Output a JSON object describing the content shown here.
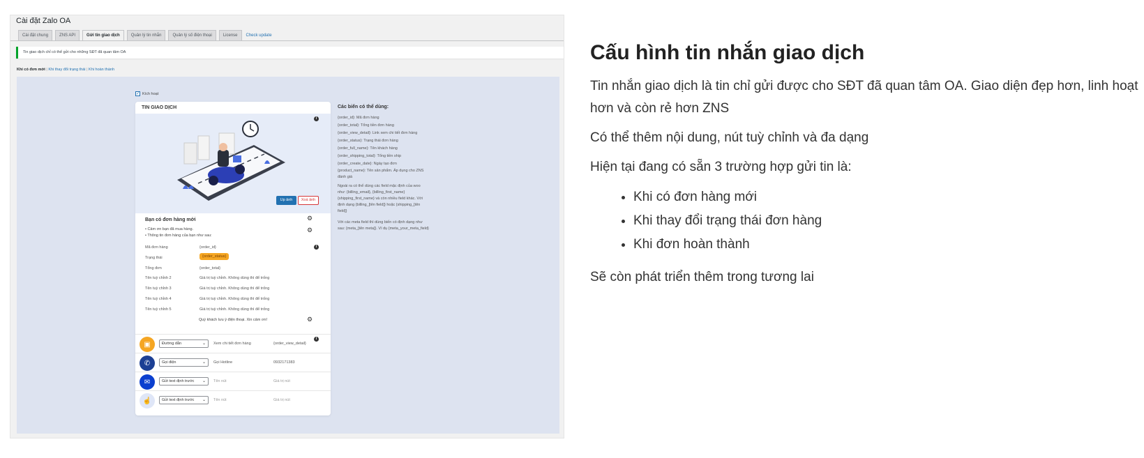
{
  "screenshot": {
    "window_title": "Cài đặt Zalo OA",
    "tabs": [
      {
        "label": "Cài đặt chung",
        "active": false
      },
      {
        "label": "ZNS API",
        "active": false
      },
      {
        "label": "Gửi tin giao dịch",
        "active": true
      },
      {
        "label": "Quản lý tin nhắn",
        "active": false
      },
      {
        "label": "Quản lý số điện thoại",
        "active": false
      },
      {
        "label": "License",
        "active": false
      }
    ],
    "check_update": "Check update",
    "notice": "Tin giao dịch chỉ có thể gửi cho những SĐT đã quan tâm OA",
    "subnav": {
      "active": "Khi có đơn mới",
      "sep1": "|",
      "link1": "Khi thay đổi trạng thái",
      "sep2": "|",
      "link2": "Khi hoàn thành"
    },
    "enable_label": "Kích hoạt",
    "card": {
      "header": "TIN GIAO DỊCH",
      "upload_btn": "Up ảnh",
      "delete_btn": "Xoá ảnh",
      "title": "Bạn có đơn hàng mới",
      "intro_line1": "• Cảm ơn bạn đã mua hàng.",
      "intro_line2": "• Thông tin đơn hàng của bạn như sau:",
      "rows": [
        {
          "label": "Mã đơn hàng",
          "value": "{order_id}"
        },
        {
          "label": "Trạng thái",
          "value": "{order_status}"
        },
        {
          "label": "Tổng đơn",
          "value": "{order_total}"
        },
        {
          "label": "Tên tuỳ chỉnh 2",
          "value": "Giá trị tuỳ chỉnh. Không dùng thì để trống"
        },
        {
          "label": "Tên tuỳ chỉnh 3",
          "value": "Giá trị tuỳ chỉnh. Không dùng thì để trống"
        },
        {
          "label": "Tên tuỳ chỉnh 4",
          "value": "Giá trị tuỳ chỉnh. Không dùng thì để trống"
        },
        {
          "label": "Tên tuỳ chỉnh 5",
          "value": "Giá trị tuỳ chỉnh. Không dùng thì để trống"
        }
      ],
      "footer_note": "Quý khách lưu ý điện thoại. Xin cảm ơn!",
      "buttons": [
        {
          "type": "Đường dẫn",
          "text": "Xem chi tiết đơn hàng",
          "value": "{order_view_detail}",
          "color": "#f5a623",
          "icon": "shop-icon"
        },
        {
          "type": "Gọi điện",
          "text": "Gọi Hotline",
          "value": "0932171383",
          "color": "#1c3f94",
          "icon": "phone-icon"
        },
        {
          "type": "Gửi text định trước",
          "text": "Tên nút",
          "value": "Giá trị nút",
          "color": "#0b3fcf",
          "icon": "chat-icon"
        },
        {
          "type": "Gửi text định trước",
          "text": "Tên nút",
          "value": "Giá trị nút",
          "color": "#dfe6f7",
          "icon": "hand-pointer-icon"
        }
      ]
    },
    "variables": {
      "title": "Các biến có thể dùng:",
      "items": [
        "{order_id}: Mã đơn hàng",
        "{order_total}: Tổng tiền đơn hàng",
        "{order_view_detail}: Link xem chi tiết đơn hàng",
        "{order_status}: Trạng thái đơn hàng",
        "{order_full_name}: Tên khách hàng",
        "{order_shipping_total}: Tổng tiền ship",
        "{order_create_date}: Ngày tạo đơn",
        "{product_name}: Tên sản phẩm. Áp dụng cho ZNS",
        "đánh giá"
      ],
      "para1_lines": [
        "Ngoài ra có thể dùng các field mặc định của woo",
        "như: {billing_email}, {billing_first_name}",
        "{shipping_first_name} và còn nhiều field khác. Với",
        "định dạng {billing_[tên field]} hoặc {shipping_[tên",
        "field]}"
      ],
      "para2_lines": [
        "Với các meta field thì dùng biến có định dạng như",
        "sau: {meta_[tên meta]}. Ví dụ {meta_your_meta_field}"
      ]
    }
  },
  "article": {
    "heading": "Cấu hình tin nhắn giao dịch",
    "p1": "Tin nhắn giao dịch là tin chỉ gửi được cho SĐT đã quan tâm OA. Giao diện đẹp hơn, linh hoạt hơn và còn rẻ hơn ZNS",
    "p2": "Có thể thêm nội dung, nút tuỳ chỉnh và đa dạng",
    "p3": "Hiện tại đang có sẵn 3 trường hợp gửi tin là:",
    "list": [
      "Khi có đơn hàng mới",
      "Khi thay đổi trạng thái đơn hàng",
      "Khi đơn hoàn thành"
    ],
    "p4": "Sẽ còn phát triển thêm trong tương lai"
  },
  "colors": {
    "wp_blue": "#2271b1",
    "status_badge": "#f5a623",
    "notice_green": "#00a32a",
    "canvas_bg": "#dde3f0"
  }
}
